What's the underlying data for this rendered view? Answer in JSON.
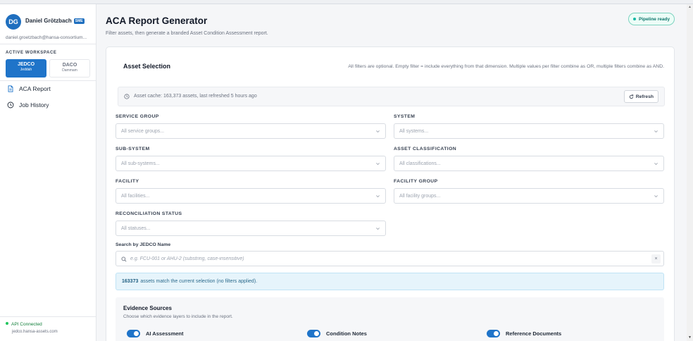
{
  "user": {
    "initials": "DG",
    "name": "Daniel Grötzbach",
    "role_badge": "SME",
    "email": "daniel.groetzbach@hansa-consortium..."
  },
  "workspace": {
    "label": "ACTIVE WORKSPACE",
    "options": [
      {
        "title": "JEDCO",
        "subtitle": "Jeddah",
        "active": true
      },
      {
        "title": "DACO",
        "subtitle": "Dammam",
        "active": false
      }
    ]
  },
  "nav": {
    "items": [
      {
        "label": "ACA Report",
        "icon": "document-icon",
        "active": true
      },
      {
        "label": "Job History",
        "icon": "clock-icon",
        "active": false
      }
    ]
  },
  "api_status": {
    "label": "API Connected",
    "host": "jedco.hansa-assets.com",
    "color": "#22c55e"
  },
  "header": {
    "title": "ACA Report Generator",
    "subtitle": "Filter assets, then generate a branded Asset Condition Assessment report.",
    "status_badge": "Pipeline ready"
  },
  "asset_selection": {
    "title": "Asset Selection",
    "hint": "All filters are optional. Empty filter = include everything from that dimension. Multiple values per filter combine as OR, multiple filters combine as AND.",
    "cache_text": "Asset cache: 163,373 assets, last refreshed 5 hours ago",
    "refresh_label": "Refresh",
    "filters": {
      "service_group": {
        "label": "SERVICE GROUP",
        "placeholder": "All service groups..."
      },
      "system": {
        "label": "SYSTEM",
        "placeholder": "All systems..."
      },
      "sub_system": {
        "label": "SUB-SYSTEM",
        "placeholder": "All sub-systems..."
      },
      "asset_classification": {
        "label": "ASSET CLASSIFICATION",
        "placeholder": "All classifications..."
      },
      "facility": {
        "label": "FACILITY",
        "placeholder": "All facilities..."
      },
      "facility_group": {
        "label": "FACILITY GROUP",
        "placeholder": "All facility groups..."
      },
      "reconciliation_status": {
        "label": "RECONCILIATION STATUS",
        "placeholder": "All statuses..."
      }
    },
    "search": {
      "label": "Search by JEDCO Name",
      "placeholder": "e.g. FCU-001 or AHU-2 (substring, case-insensitive)",
      "value": "",
      "clear_glyph": "×"
    },
    "match": {
      "count": "163373",
      "text": "assets match the current selection (no filters applied)."
    }
  },
  "evidence": {
    "title": "Evidence Sources",
    "subtitle": "Choose which evidence layers to include in the report.",
    "sources": [
      {
        "label": "AI Assessment",
        "enabled": true
      },
      {
        "label": "Condition Notes",
        "enabled": true
      },
      {
        "label": "Reference Documents",
        "enabled": true
      }
    ]
  },
  "colors": {
    "accent": "#1f74c9",
    "pipeline_ok": "#14b8a6",
    "info_bg": "#e6f4fb"
  }
}
